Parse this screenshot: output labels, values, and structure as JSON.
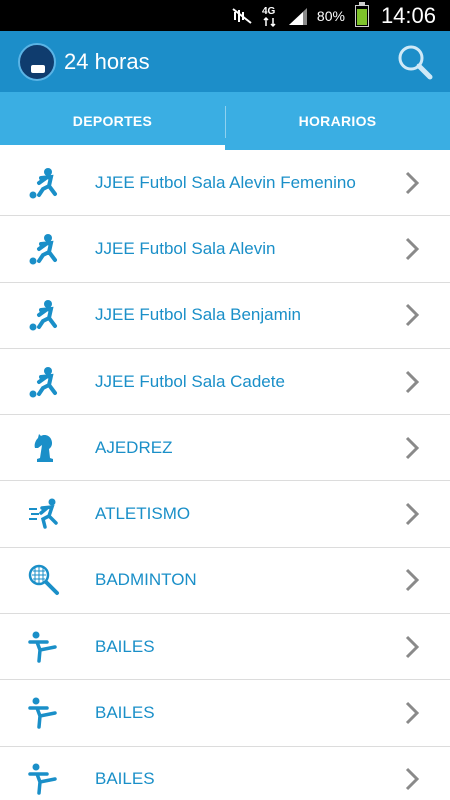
{
  "status_bar": {
    "battery_percent": "80%",
    "time": "14:06",
    "network": "4G"
  },
  "action_bar": {
    "title": "24 horas"
  },
  "tabs": [
    {
      "label": "DEPORTES",
      "active": true
    },
    {
      "label": "HORARIOS",
      "active": false
    }
  ],
  "colors": {
    "action_bar": "#1c8ec9",
    "tabs": "#3aaee3",
    "accent_text": "#1a8fc8"
  },
  "items": [
    {
      "label": "JJEE Futbol Sala Alevin Femenino",
      "icon": "soccer-player-icon"
    },
    {
      "label": "JJEE Futbol Sala Alevin",
      "icon": "soccer-player-icon"
    },
    {
      "label": "JJEE Futbol Sala Benjamin",
      "icon": "soccer-player-icon"
    },
    {
      "label": "JJEE Futbol Sala Cadete",
      "icon": "soccer-player-icon"
    },
    {
      "label": "AJEDREZ",
      "icon": "chess-knight-icon"
    },
    {
      "label": "ATLETISMO",
      "icon": "runner-icon"
    },
    {
      "label": "BADMINTON",
      "icon": "badminton-racket-icon"
    },
    {
      "label": "BAILES",
      "icon": "dancer-icon"
    },
    {
      "label": "BAILES",
      "icon": "dancer-icon"
    },
    {
      "label": "BAILES",
      "icon": "dancer-icon"
    }
  ]
}
